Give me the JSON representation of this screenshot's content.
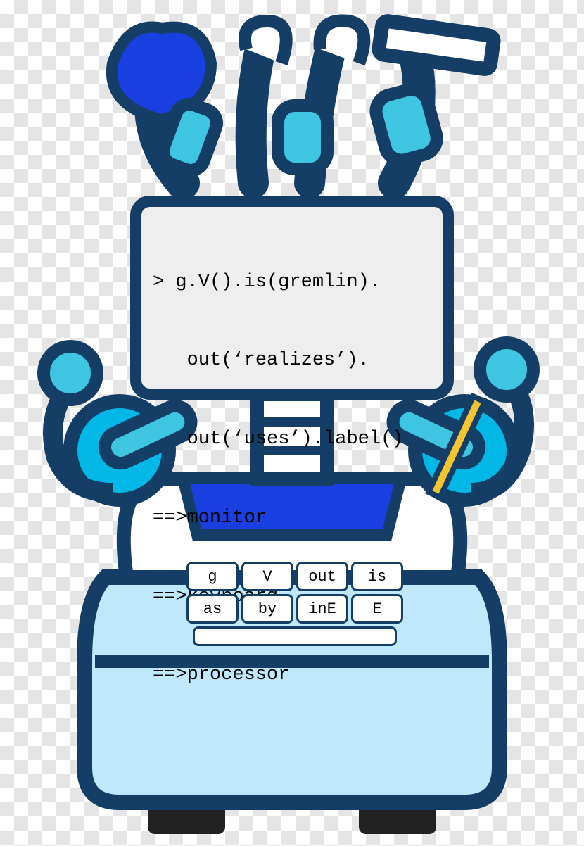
{
  "monitor": {
    "lines": [
      "> g.V().is(gremlin).",
      "   out(‘realizes’).",
      "   out(‘uses’).label()",
      "==>monitor",
      "==>keyboard",
      "==>processor"
    ]
  },
  "keyboard": {
    "row1": [
      "g",
      "V",
      "out",
      "is"
    ],
    "row2": [
      "as",
      "by",
      "inE",
      "E"
    ]
  }
}
